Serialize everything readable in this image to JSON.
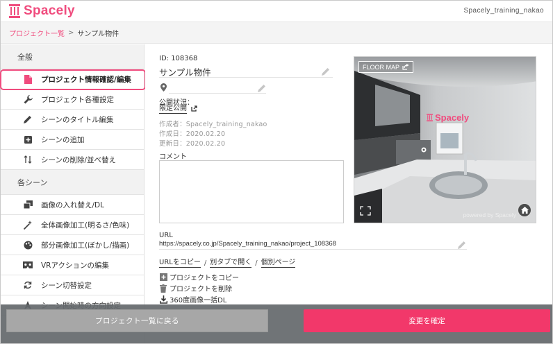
{
  "header": {
    "logo_text": "Spacely",
    "user_name": "Spacely_training_nakao"
  },
  "breadcrumb": {
    "link": "プロジェクト一覧",
    "separator": ">",
    "current": "サンプル物件"
  },
  "sidebar": {
    "section_general": "全般",
    "general_items": [
      {
        "label": "プロジェクト情報確認/編集",
        "icon": "document-icon",
        "active": true
      },
      {
        "label": "プロジェクト各種設定",
        "icon": "wrench-icon"
      },
      {
        "label": "シーンのタイトル編集",
        "icon": "pencil-icon"
      },
      {
        "label": "シーンの追加",
        "icon": "plus-box-icon"
      },
      {
        "label": "シーンの削除/並べ替え",
        "icon": "sort-icon"
      }
    ],
    "section_scenes": "各シーン",
    "scene_items": [
      {
        "label": "画像の入れ替え/DL",
        "icon": "image-swap-icon"
      },
      {
        "label": "全体画像加工(明るさ/色味)",
        "icon": "magic-wand-icon"
      },
      {
        "label": "部分画像加工(ぼかし/描画)",
        "icon": "palette-icon"
      },
      {
        "label": "VRアクションの編集",
        "icon": "vr-goggles-icon"
      },
      {
        "label": "シーン切替設定",
        "icon": "refresh-icon"
      },
      {
        "label": "シーン開始時の方向設定",
        "icon": "direction-icon"
      }
    ]
  },
  "project": {
    "id_label": "ID: 108368",
    "name": "サンプル物件",
    "location": "",
    "publish_label": "公開状況：",
    "publish_status": "限定公開",
    "creator": "作成者：Spacely_training_nakao",
    "created": "作成日：2020.02.20",
    "updated": "更新日：2020.02.20",
    "comment_label": "コメント",
    "comment": ""
  },
  "preview": {
    "floor_map": "FLOOR MAP",
    "brand": "Spacely",
    "powered": "powered by Spacely"
  },
  "url": {
    "label": "URL",
    "value": "https://spacely.co.jp/Spacely_training_nakao/project_108368",
    "copy": "URLをコピー",
    "open_tab": "別タブで開く",
    "individual": "個別ページ",
    "sep": "/"
  },
  "operations": {
    "copy_project": "プロジェクトをコピー",
    "delete_project": "プロジェクトを削除",
    "bulk_download": "360度画像一括DL"
  },
  "footer": {
    "back": "プロジェクト一覧に戻る",
    "confirm": "変更を確定"
  },
  "colors": {
    "accent": "#f04c7e",
    "confirm": "#f2386a"
  }
}
